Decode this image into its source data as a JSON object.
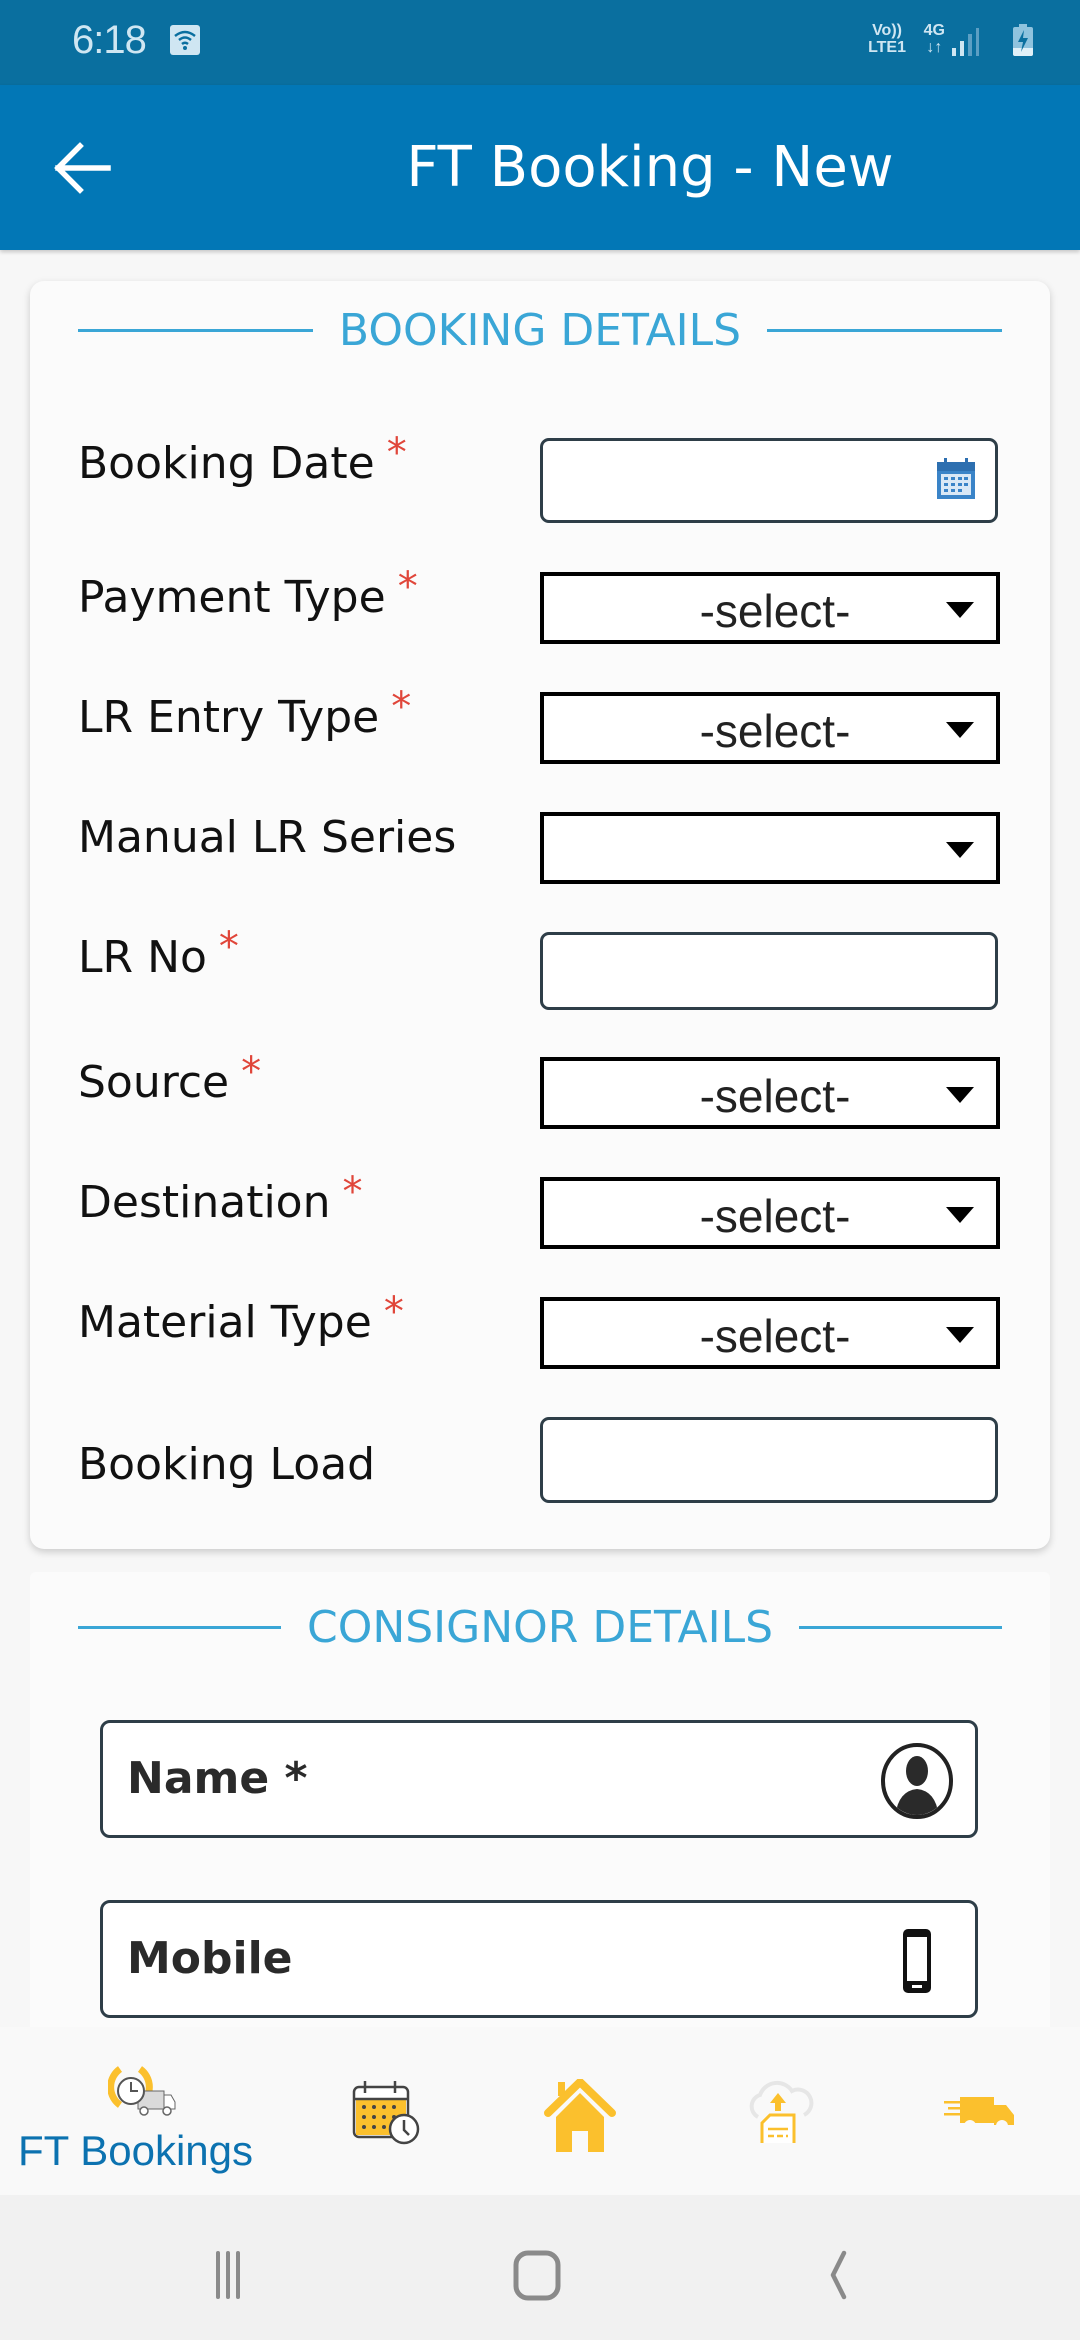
{
  "status_bar": {
    "time": "6:18",
    "wifi_icon": "wifi-icon",
    "volte_label": "Vo))",
    "lte_label": "LTE1",
    "network_label": "4G",
    "network_arrows": "↓↑",
    "signal_icon": "signal-icon",
    "battery_icon": "battery-charging-icon"
  },
  "app_bar": {
    "back_icon": "arrow-left-icon",
    "title": "FT Booking - New",
    "color": "#0277b6"
  },
  "booking_details": {
    "heading": "BOOKING DETAILS",
    "fields": [
      {
        "label": "Booking Date",
        "required": "*",
        "type": "date",
        "value": "",
        "icon": "calendar-icon"
      },
      {
        "label": "Payment Type",
        "required": "*",
        "type": "select",
        "value": "-select-"
      },
      {
        "label": "LR Entry Type",
        "required": "*",
        "type": "select",
        "value": "-select-"
      },
      {
        "label": "Manual LR Series",
        "required": "",
        "type": "select",
        "value": ""
      },
      {
        "label": "LR No",
        "required": "*",
        "type": "text",
        "value": ""
      },
      {
        "label": "Source",
        "required": "*",
        "type": "select",
        "value": "-select-"
      },
      {
        "label": "Destination",
        "required": "*",
        "type": "select",
        "value": "-select-"
      },
      {
        "label": "Material Type",
        "required": "*",
        "type": "select",
        "value": "-select-"
      },
      {
        "label": "Booking Load",
        "required": "",
        "type": "text",
        "value": ""
      }
    ]
  },
  "consignor_details": {
    "heading": "CONSIGNOR DETAILS",
    "fields": [
      {
        "label": "Name *",
        "value": "",
        "icon": "user-icon"
      },
      {
        "label": "Mobile",
        "value": "",
        "icon": "mobile-phone-icon"
      }
    ]
  },
  "bottom_nav": {
    "items": [
      {
        "label": "FT Bookings",
        "icon": "truck-clock-icon",
        "active": true
      },
      {
        "label": "",
        "icon": "calendar-clock-icon",
        "active": false
      },
      {
        "label": "",
        "icon": "home-icon",
        "active": false
      },
      {
        "label": "",
        "icon": "cloud-upload-document-icon",
        "active": false
      },
      {
        "label": "",
        "icon": "fast-delivery-truck-icon",
        "active": false
      }
    ],
    "accent": "#fbc02d",
    "active_label_color": "#0c72b0"
  },
  "system_nav": {
    "recent_icon": "recent-apps-icon",
    "home_icon": "home-button-icon",
    "back_icon": "back-chevron-icon"
  },
  "colors": {
    "section_heading": "#3aa6d6",
    "required_marker": "#e0463a"
  }
}
